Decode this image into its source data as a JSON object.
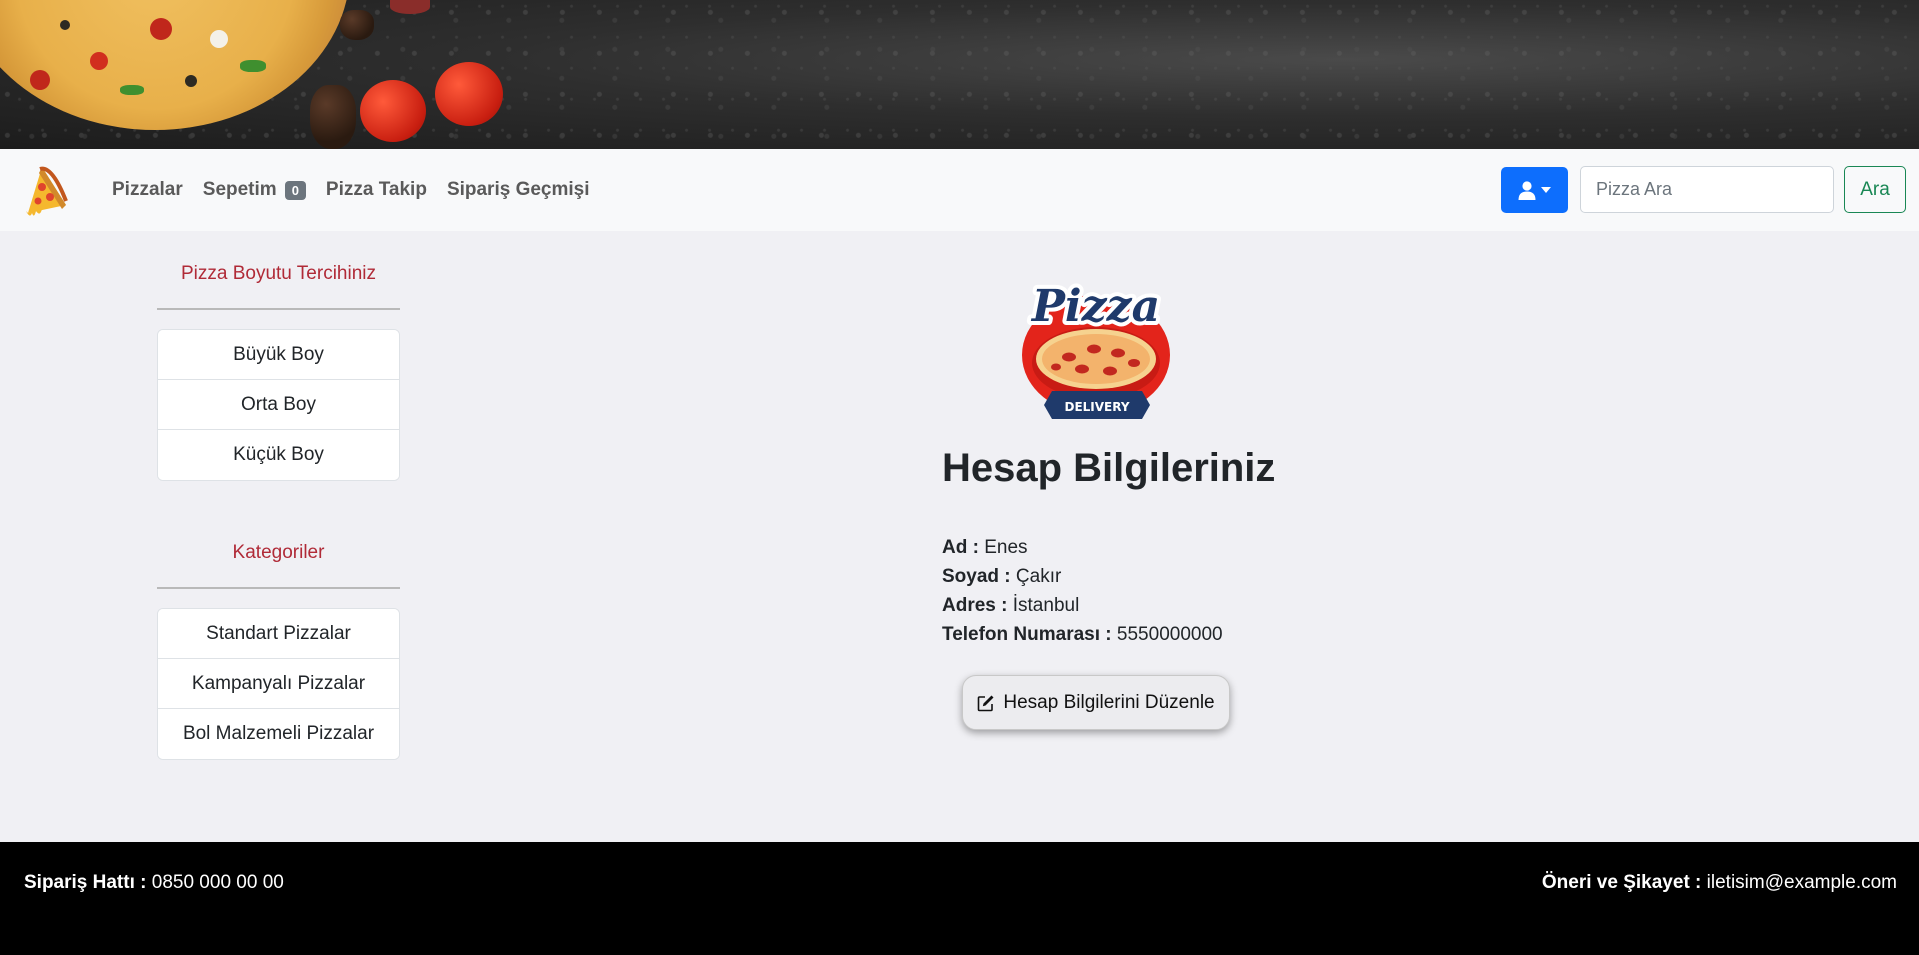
{
  "navbar": {
    "links": [
      {
        "label": "Pizzalar"
      },
      {
        "label": "Sepetim",
        "badge": "0"
      },
      {
        "label": "Pizza Takip"
      },
      {
        "label": "Sipariş Geçmişi"
      }
    ],
    "search": {
      "placeholder": "Pizza Ara",
      "button_label": "Ara"
    },
    "user_button_icon": "user-icon"
  },
  "sidebar": {
    "size_title": "Pizza Boyutu Tercihiniz",
    "sizes": [
      "Büyük Boy",
      "Orta Boy",
      "Küçük Boy"
    ],
    "category_title": "Kategoriler",
    "categories": [
      "Standart Pizzalar",
      "Kampanyalı Pizzalar",
      "Bol Malzemeli Pizzalar"
    ]
  },
  "main": {
    "logo_text": "Pizza",
    "logo_subtext": "DELIVERY",
    "heading": "Hesap Bilgileriniz",
    "fields": [
      {
        "label": "Ad :",
        "value": "Enes"
      },
      {
        "label": "Soyad :",
        "value": "Çakır"
      },
      {
        "label": "Adres :",
        "value": "İstanbul"
      },
      {
        "label": "Telefon Numarası :",
        "value": "5550000000"
      }
    ],
    "edit_button": "Hesap Bilgilerini Düzenle"
  },
  "footer": {
    "left_label": "Sipariş Hattı :",
    "left_value": "0850 000 00 00",
    "right_label": "Öneri ve Şikayet :",
    "right_value": "iletisim@example.com"
  },
  "colors": {
    "primary": "#0d6efd",
    "success": "#198754",
    "danger_text": "#b02a37",
    "badge": "#6c757d"
  }
}
